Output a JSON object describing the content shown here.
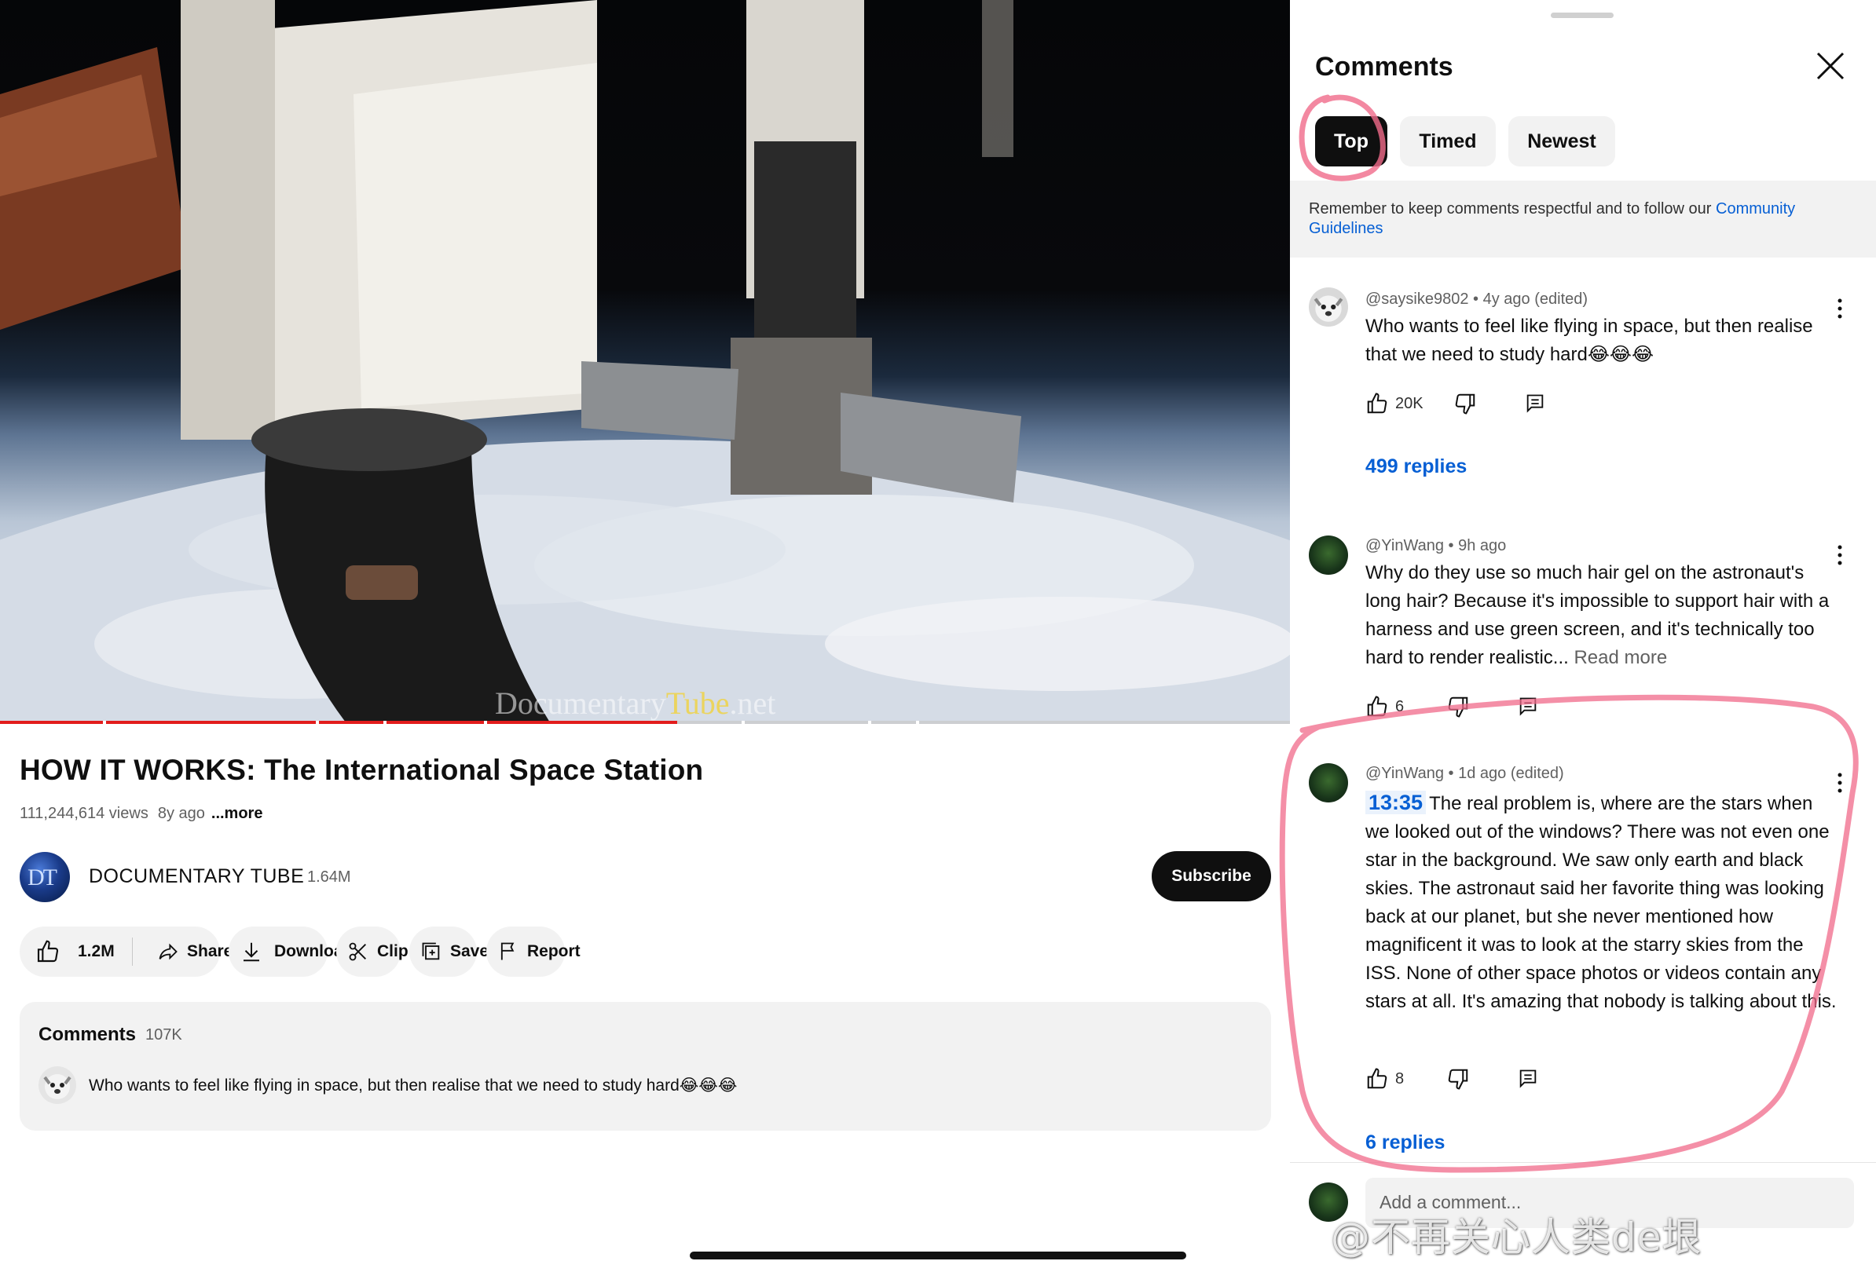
{
  "video": {
    "watermark_prefix": "Documentary",
    "watermark_tube": "Tube",
    "watermark_suffix": ".net",
    "progress_fraction": 0.525,
    "chapter_markers_fraction": [
      0.08,
      0.245,
      0.297,
      0.375,
      0.575,
      0.673,
      0.71
    ]
  },
  "title": "HOW IT WORKS: The International Space Station",
  "meta": {
    "views": "111,244,614 views",
    "age": "8y ago",
    "more": "...more"
  },
  "channel": {
    "name": "DOCUMENTARY TUBE",
    "subscribers": "1.64M",
    "avatar_text": "DT",
    "subscribe_label": "Subscribe"
  },
  "actions": {
    "like_count": "1.2M",
    "share": "Share",
    "download": "Download",
    "clip": "Clip",
    "save": "Save",
    "report": "Report"
  },
  "comments_preview": {
    "title": "Comments",
    "count": "107K",
    "text": "Who wants to feel like flying in space, but then realise that we need to study hard😂😂😂"
  },
  "panel": {
    "title": "Comments",
    "chips": [
      "Top",
      "Timed",
      "Newest"
    ],
    "guideline_text": "Remember to keep comments respectful and to follow our ",
    "guideline_link": "Community Guidelines",
    "comments": [
      {
        "author": "@saysike9802",
        "age": "4y ago (edited)",
        "text": "Who wants to feel like flying in space, but then realise that we need to study hard😂😂😂",
        "likes": "20K",
        "replies": "499 replies"
      },
      {
        "author": "@YinWang",
        "age": "9h ago",
        "text": "Why do they use so much hair gel on the astronaut's long hair? Because it's impossible to support hair with a harness and use green screen, and it's technically too hard to render realistic...",
        "read_more": "Read more",
        "likes": "6"
      },
      {
        "author": "@YinWang",
        "age": "1d ago (edited)",
        "timestamp": "13:35",
        "text": "The real problem is, where are the stars when we looked out of the windows? There was not even one star in the background. We saw only earth and black skies. The astronaut said her favorite thing was looking back at our planet, but she never mentioned how magnificent it was to look at the starry skies from the ISS. None of other space photos or videos contain any stars at all. It's amazing that nobody is talking about this.",
        "likes": "8",
        "replies": "6 replies"
      }
    ],
    "add_comment_placeholder": "Add a comment..."
  },
  "overlay_watermark": "@不再关心人类de垠",
  "colors": {
    "accent_blue": "#065fd4",
    "progress_red": "#e21c1c",
    "highlight_pink": "#f06a8a"
  }
}
